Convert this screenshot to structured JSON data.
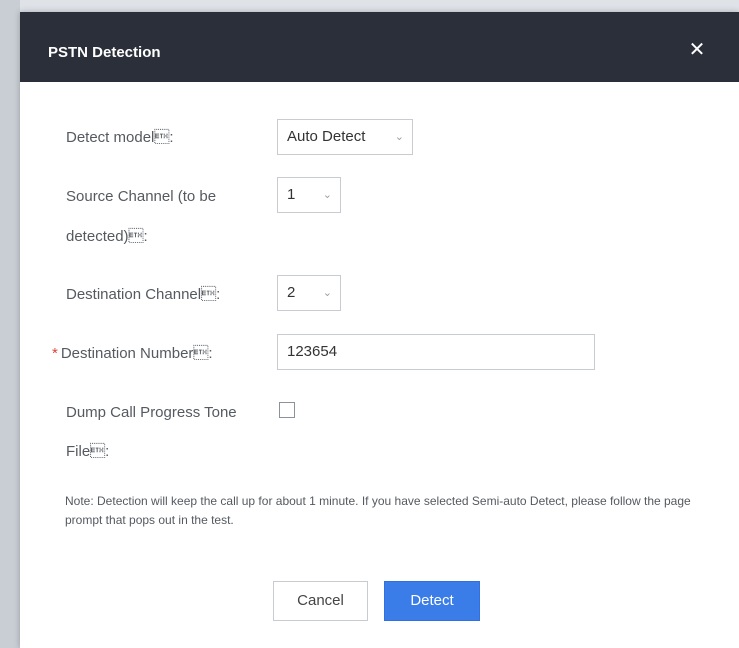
{
  "dialog": {
    "title": "PSTN Detection",
    "close_glyph": "✕"
  },
  "form": {
    "detect_model": {
      "label": "Detect model\u0003:",
      "value": "Auto Detect"
    },
    "source_channel": {
      "label_line1": "Source Channel (to be",
      "label_line2": "detected)\u0003:",
      "value": "1"
    },
    "destination_channel": {
      "label": "Destination Channel\u0003:",
      "value": "2"
    },
    "destination_number": {
      "required_mark": "*",
      "label": "Destination Number\u0003:",
      "value": "123654"
    },
    "dump_call_progress": {
      "label_line1": "Dump Call Progress Tone",
      "label_line2": "File\u0003:",
      "checked": false
    }
  },
  "note": "Note: Detection will keep the call up for about 1 minute. If you have selected Semi-auto Detect, please follow the page prompt that pops out in the test.",
  "buttons": {
    "cancel": "Cancel",
    "detect": "Detect"
  },
  "icons": {
    "chevron": "⌄"
  },
  "colors": {
    "header_bg": "#2b2f3a",
    "primary": "#3a7ce8",
    "required": "#e0403a"
  }
}
